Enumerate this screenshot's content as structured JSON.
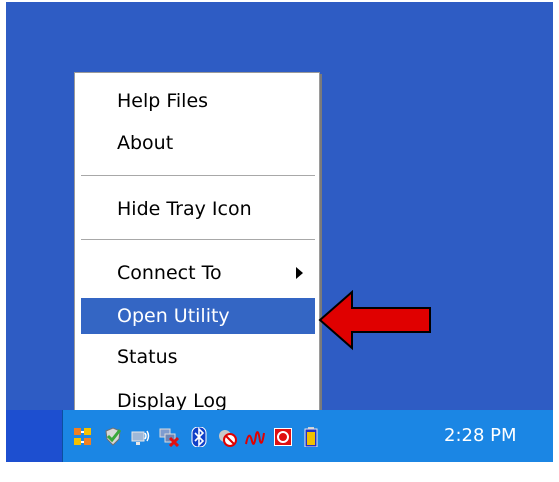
{
  "menu": {
    "items": [
      {
        "label": "Help Files"
      },
      {
        "label": "About"
      },
      {
        "label": "Hide Tray Icon"
      },
      {
        "label": "Connect To",
        "has_submenu": true
      },
      {
        "label": "Open Utility",
        "highlighted": true
      },
      {
        "label": "Status"
      },
      {
        "label": "Display Log"
      }
    ],
    "highlight_color": "#3466c4"
  },
  "taskbar": {
    "clock": "2:28 PM",
    "tray_icons": [
      "network-grid-icon",
      "security-shield-icon",
      "wireless-monitor-icon",
      "network-disconnected-icon",
      "bluetooth-icon",
      "no-sign-icon",
      "audio-waves-icon",
      "red-app-icon",
      "battery-icon"
    ]
  },
  "annotation": {
    "pointer_color": "#e00000"
  },
  "colors": {
    "desktop": "#2e5cc4",
    "tray": "#1b86e4"
  }
}
